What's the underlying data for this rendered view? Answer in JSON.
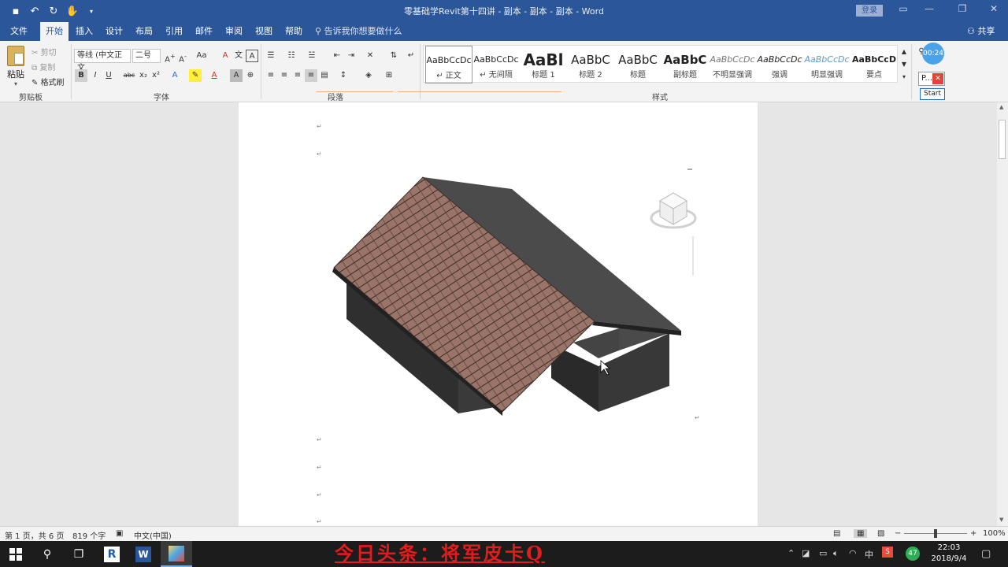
{
  "window": {
    "title": "零基础学Revit第十四讲 - 副本 - 副本 - 副本  -  Word",
    "login_label": "登录",
    "share_label": "共享",
    "tell_me": "告诉我你想要做什么"
  },
  "tabs": [
    "文件",
    "开始",
    "插入",
    "设计",
    "布局",
    "引用",
    "邮件",
    "审阅",
    "视图",
    "帮助"
  ],
  "ribbon": {
    "clipboard": {
      "paste": "粘贴",
      "cut": "剪切",
      "copy": "复制",
      "format_painter": "格式刷",
      "label": "剪贴板"
    },
    "font": {
      "name": "等线 (中文正文",
      "size": "二号",
      "label": "字体"
    },
    "paragraph": {
      "label": "段落"
    },
    "styles": {
      "label": "样式",
      "items": [
        {
          "preview": "AaBbCcDc",
          "name": "↵ 正文"
        },
        {
          "preview": "AaBbCcDc",
          "name": "↵ 无间隔"
        },
        {
          "preview": "AaBl",
          "name": "标题 1"
        },
        {
          "preview": "AaBbC",
          "name": "标题 2"
        },
        {
          "preview": "AaBbC",
          "name": "标题"
        },
        {
          "preview": "AaBbC",
          "name": "副标题"
        },
        {
          "preview": "AaBbCcDc",
          "name": "不明显强调"
        },
        {
          "preview": "AaBbCcDc",
          "name": "强调"
        },
        {
          "preview": "AaBbCcDc",
          "name": "明显强调"
        },
        {
          "preview": "AaBbCcD",
          "name": "要点"
        }
      ]
    }
  },
  "overlay": {
    "timer": "00:24",
    "panel": "P...",
    "start": "Start"
  },
  "status": {
    "page": "第 1 页，共 6 页",
    "words": "819 个字",
    "lang": "中文(中国)",
    "zoom": "100%"
  },
  "taskbar": {
    "watermark": "今日头条：将军皮卡Q",
    "time": "22:03",
    "date": "2018/9/4",
    "ime": "中",
    "badge": "47"
  },
  "colors": {
    "accent": "#2b579a",
    "roof_tile": "#9a7468",
    "wall": "#2e2e2e",
    "roof_dark": "#4b4b4b"
  }
}
